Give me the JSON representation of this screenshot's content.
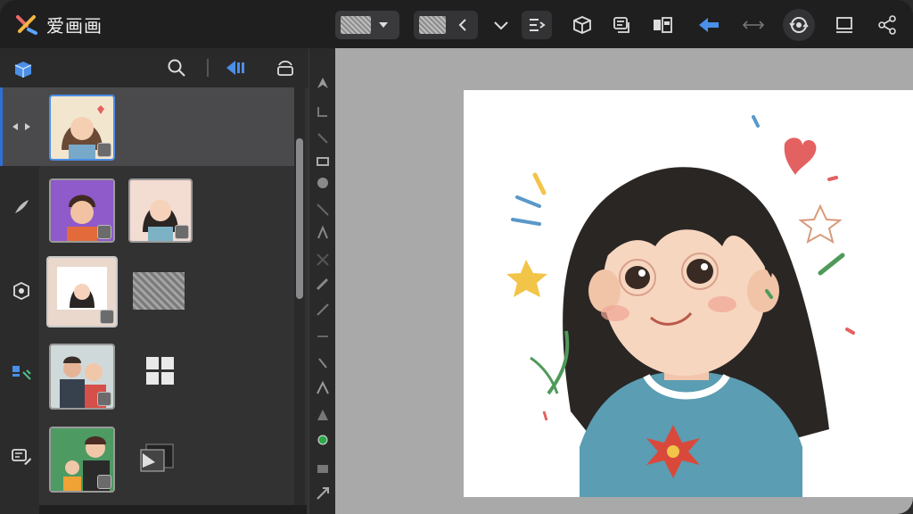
{
  "app": {
    "title": "爱画画",
    "accent": "#2f6fd6",
    "logo_colors": [
      "#f06a6a",
      "#f4b740",
      "#5aa7ff"
    ]
  },
  "toolbar": {
    "items": [
      {
        "name": "layer-preset-select-icon",
        "icon": "dropdown-icon"
      },
      {
        "name": "back-icon",
        "icon": "chevron-left-icon"
      },
      {
        "name": "more-icon",
        "icon": "chevron-down-icon"
      },
      {
        "name": "sequence-icon",
        "icon": "list-arrow-icon"
      },
      {
        "name": "3d-object-icon",
        "icon": "cube-icon"
      },
      {
        "name": "notes-icon",
        "icon": "notes-icon"
      },
      {
        "name": "component-icon",
        "icon": "component-icon"
      },
      {
        "name": "undo-icon",
        "icon": "undo-arrow-icon"
      },
      {
        "name": "flip-icon",
        "icon": "flip-horizontal-icon"
      },
      {
        "name": "reference-icon",
        "icon": "rotate-eye-icon"
      },
      {
        "name": "display-icon",
        "icon": "monitor-icon"
      },
      {
        "name": "share-icon",
        "icon": "share-icon"
      }
    ]
  },
  "sidebar": {
    "rail": [
      {
        "icon": "cube-icon"
      },
      {
        "icon": "shuffle-icon"
      },
      {
        "icon": "brush-icon"
      },
      {
        "icon": "frame-icon"
      },
      {
        "icon": "collaborate-icon"
      },
      {
        "icon": "chat-edit-icon"
      }
    ],
    "header_icons": [
      "search-icon",
      "merge-layers-icon",
      "transform-icon"
    ]
  },
  "canvas": {
    "background": "#a9a9a9",
    "paper_color": "#ffffff"
  }
}
